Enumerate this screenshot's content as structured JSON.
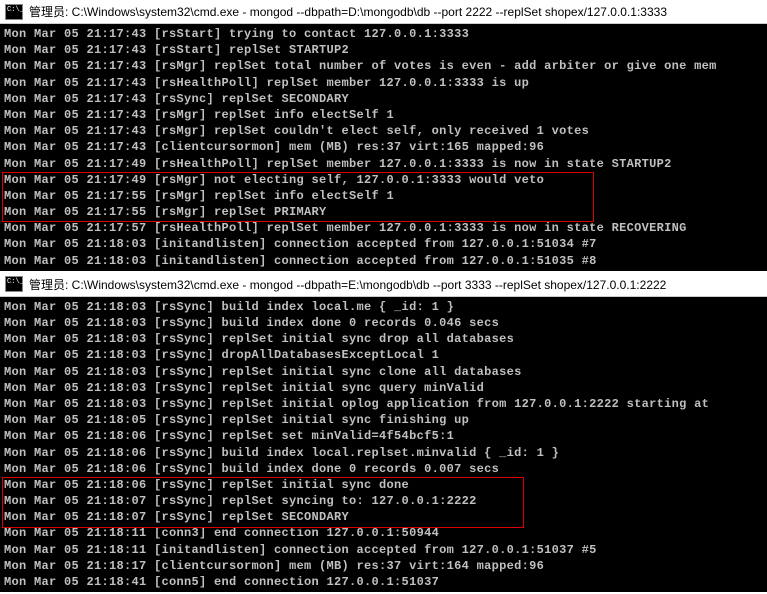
{
  "window1": {
    "title_prefix": "管理员: ",
    "title": "C:\\Windows\\system32\\cmd.exe - mongod  --dbpath=D:\\mongodb\\db --port 2222 --replSet shopex/127.0.0.1:3333",
    "log": [
      "Mon Mar 05 21:17:43 [rsStart] trying to contact 127.0.0.1:3333",
      "Mon Mar 05 21:17:43 [rsStart] replSet STARTUP2",
      "Mon Mar 05 21:17:43 [rsMgr] replSet total number of votes is even - add arbiter or give one mem",
      "Mon Mar 05 21:17:43 [rsHealthPoll] replSet member 127.0.0.1:3333 is up",
      "Mon Mar 05 21:17:43 [rsSync] replSet SECONDARY",
      "Mon Mar 05 21:17:43 [rsMgr] replSet info electSelf 1",
      "Mon Mar 05 21:17:43 [rsMgr] replSet couldn't elect self, only received 1 votes",
      "Mon Mar 05 21:17:43 [clientcursormon] mem (MB) res:37 virt:165 mapped:96",
      "Mon Mar 05 21:17:49 [rsHealthPoll] replSet member 127.0.0.1:3333 is now in state STARTUP2",
      "Mon Mar 05 21:17:49 [rsMgr] not electing self, 127.0.0.1:3333 would veto",
      "Mon Mar 05 21:17:55 [rsMgr] replSet info electSelf 1",
      "Mon Mar 05 21:17:55 [rsMgr] replSet PRIMARY",
      "Mon Mar 05 21:17:57 [rsHealthPoll] replSet member 127.0.0.1:3333 is now in state RECOVERING",
      "Mon Mar 05 21:18:03 [initandlisten] connection accepted from 127.0.0.1:51034 #7",
      "Mon Mar 05 21:18:03 [initandlisten] connection accepted from 127.0.0.1:51035 #8"
    ],
    "highlight": {
      "start": 9,
      "end": 11
    }
  },
  "window2": {
    "title_prefix": "管理员: ",
    "title": "C:\\Windows\\system32\\cmd.exe - mongod  --dbpath=E:\\mongodb\\db --port 3333 --replSet shopex/127.0.0.1:2222",
    "log": [
      "Mon Mar 05 21:18:03 [rsSync] build index local.me { _id: 1 }",
      "Mon Mar 05 21:18:03 [rsSync] build index done 0 records 0.046 secs",
      "Mon Mar 05 21:18:03 [rsSync] replSet initial sync drop all databases",
      "Mon Mar 05 21:18:03 [rsSync] dropAllDatabasesExceptLocal 1",
      "Mon Mar 05 21:18:03 [rsSync] replSet initial sync clone all databases",
      "Mon Mar 05 21:18:03 [rsSync] replSet initial sync query minValid",
      "Mon Mar 05 21:18:03 [rsSync] replSet initial oplog application from 127.0.0.1:2222 starting at ",
      "Mon Mar 05 21:18:05 [rsSync] replSet initial sync finishing up",
      "Mon Mar 05 21:18:06 [rsSync] replSet set minValid=4f54bcf5:1",
      "Mon Mar 05 21:18:06 [rsSync] build index local.replset.minvalid { _id: 1 }",
      "Mon Mar 05 21:18:06 [rsSync] build index done 0 records 0.007 secs",
      "Mon Mar 05 21:18:06 [rsSync] replSet initial sync done",
      "Mon Mar 05 21:18:07 [rsSync] replSet syncing to: 127.0.0.1:2222",
      "Mon Mar 05 21:18:07 [rsSync] replSet SECONDARY",
      "Mon Mar 05 21:18:11 [conn3] end connection 127.0.0.1:50944",
      "Mon Mar 05 21:18:11 [initandlisten] connection accepted from 127.0.0.1:51037 #5",
      "Mon Mar 05 21:18:17 [clientcursormon] mem (MB) res:37 virt:164 mapped:96",
      "Mon Mar 05 21:18:41 [conn5] end connection 127.0.0.1:51037"
    ],
    "highlight": {
      "start": 11,
      "end": 13
    }
  }
}
